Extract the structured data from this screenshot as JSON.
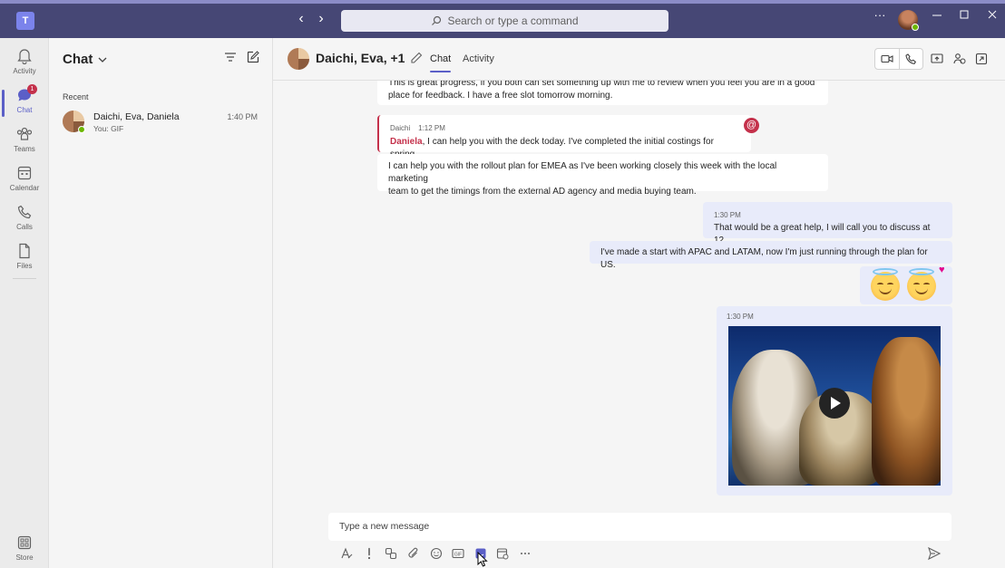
{
  "titlebar": {
    "search_placeholder": "Search or type a command",
    "more_label": "···"
  },
  "rail": {
    "items": [
      {
        "label": "Activity",
        "icon": "bell-icon"
      },
      {
        "label": "Chat",
        "icon": "chat-icon",
        "badge": "1",
        "active": true
      },
      {
        "label": "Teams",
        "icon": "teams-icon"
      },
      {
        "label": "Calendar",
        "icon": "calendar-icon"
      },
      {
        "label": "Calls",
        "icon": "phone-icon"
      },
      {
        "label": "Files",
        "icon": "file-icon"
      }
    ],
    "store_label": "Store"
  },
  "chat_list": {
    "title": "Chat",
    "section": "Recent",
    "items": [
      {
        "name": "Daichi, Eva, Daniela",
        "preview": "You: GIF",
        "time": "1:40 PM"
      }
    ]
  },
  "chat_header": {
    "title": "Daichi, Eva, +1",
    "tabs": [
      {
        "label": "Chat",
        "active": true
      },
      {
        "label": "Activity",
        "active": false
      }
    ]
  },
  "messages": {
    "m1_line1": "This is great progress, if you both can set something up with me to review when you feel you are in a good",
    "m1_line2": "place for feedback. I have a free slot tomorrow morning.",
    "m2_sender": "Daichi",
    "m2_time": "1:12 PM",
    "m2_mention": "Daniela",
    "m2_text": ", I can help you with the deck today. I've completed the initial costings for spring.",
    "m3_line1": "I can help you with the rollout plan for EMEA as I've been working closely this week with the local marketing",
    "m3_line2": "team to get the timings from the external AD agency and media buying team.",
    "m4_time": "1:30 PM",
    "m4_text": "That would be a great help, I will call you to discuss at 12.",
    "m5_text": "I've made a start with APAC and LATAM, now I'm just running through the plan for US.",
    "m6_time": "1:30 PM"
  },
  "compose": {
    "placeholder": "Type a new message"
  },
  "colors": {
    "titlebar": "#464775",
    "accent": "#5b5fc7",
    "outgoing_bubble": "#e8ebfa",
    "mention": "#c4314b"
  }
}
